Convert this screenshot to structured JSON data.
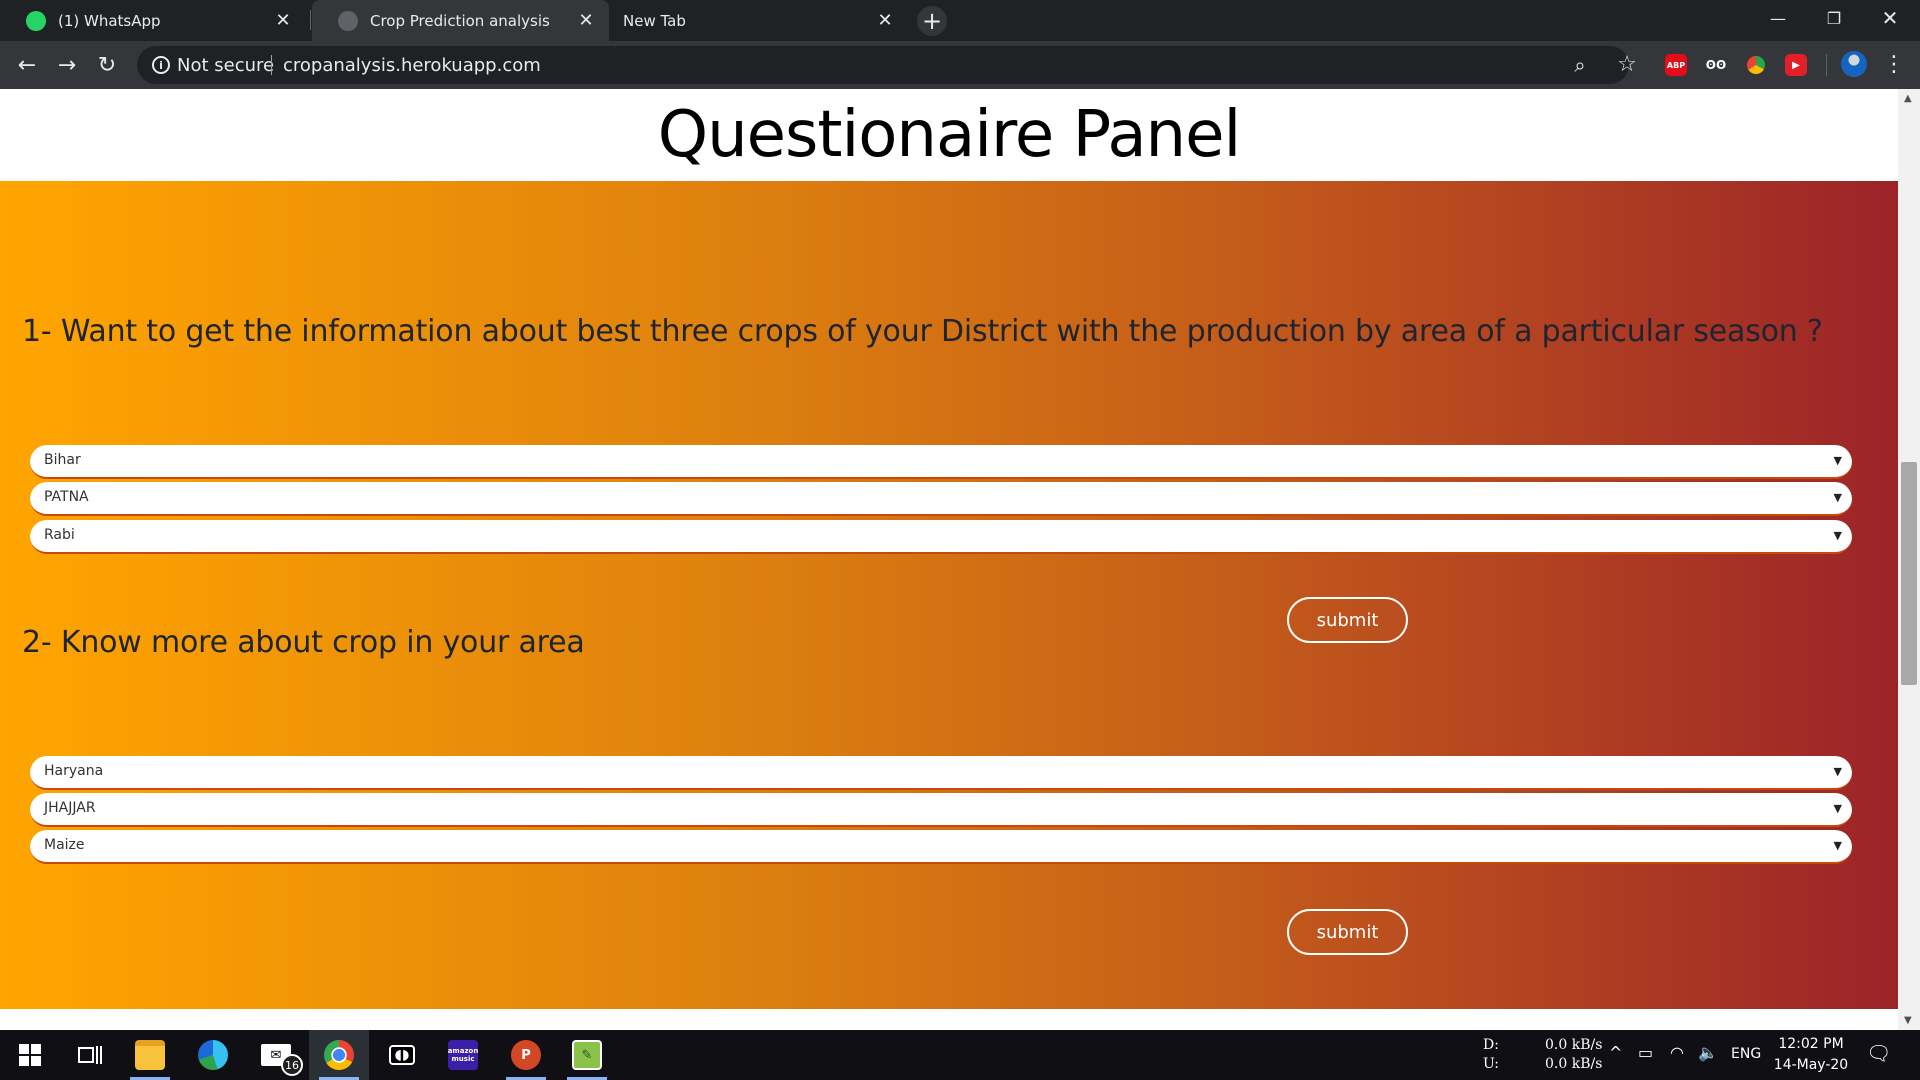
{
  "browser": {
    "tabs": [
      {
        "title": "(1) WhatsApp",
        "favicon_color": "#25d366"
      },
      {
        "title": "Crop Prediction analysis",
        "favicon_color": "#5f6368"
      },
      {
        "title": "New Tab",
        "favicon_color": ""
      }
    ],
    "active_tab_index": 1,
    "new_tab_symbol": "+",
    "security_label": "Not secure",
    "url": "cropanalysis.herokuapp.com",
    "extensions": [
      {
        "label": "ABP",
        "color": "#e40d17"
      },
      {
        "label": "ʘʘ",
        "color": "#35363a"
      },
      {
        "label": "",
        "color": "#2aa745"
      },
      {
        "label": "▶",
        "color": "#e2202a"
      }
    ]
  },
  "page": {
    "heading": "Questionaire Panel",
    "questions": [
      {
        "text": "1- Want to get the information about best three crops of your District with the production by area of a particular season ?",
        "selects": [
          "Bihar",
          "PATNA",
          "Rabi"
        ],
        "submit_label": "submit"
      },
      {
        "text": "2- Know more about crop in your area",
        "selects": [
          "Haryana",
          "JHAJJAR",
          "Maize"
        ],
        "submit_label": "submit"
      }
    ],
    "gradient_colors": [
      "#ffa500",
      "#9c2329"
    ]
  },
  "taskbar": {
    "apps": [
      "start",
      "task-view",
      "file-explorer",
      "edge",
      "mail",
      "chrome",
      "dolby",
      "amazon-music",
      "powerpoint",
      "notepad++"
    ],
    "mail_badge": "16",
    "amazon_label": "amazon music",
    "network": {
      "down_label": "D:",
      "up_label": "U:",
      "down_value": "0.0 kB/s",
      "up_value": "0.0 kB/s"
    },
    "language": "ENG",
    "time": "12:02 PM",
    "date": "14-May-20"
  }
}
